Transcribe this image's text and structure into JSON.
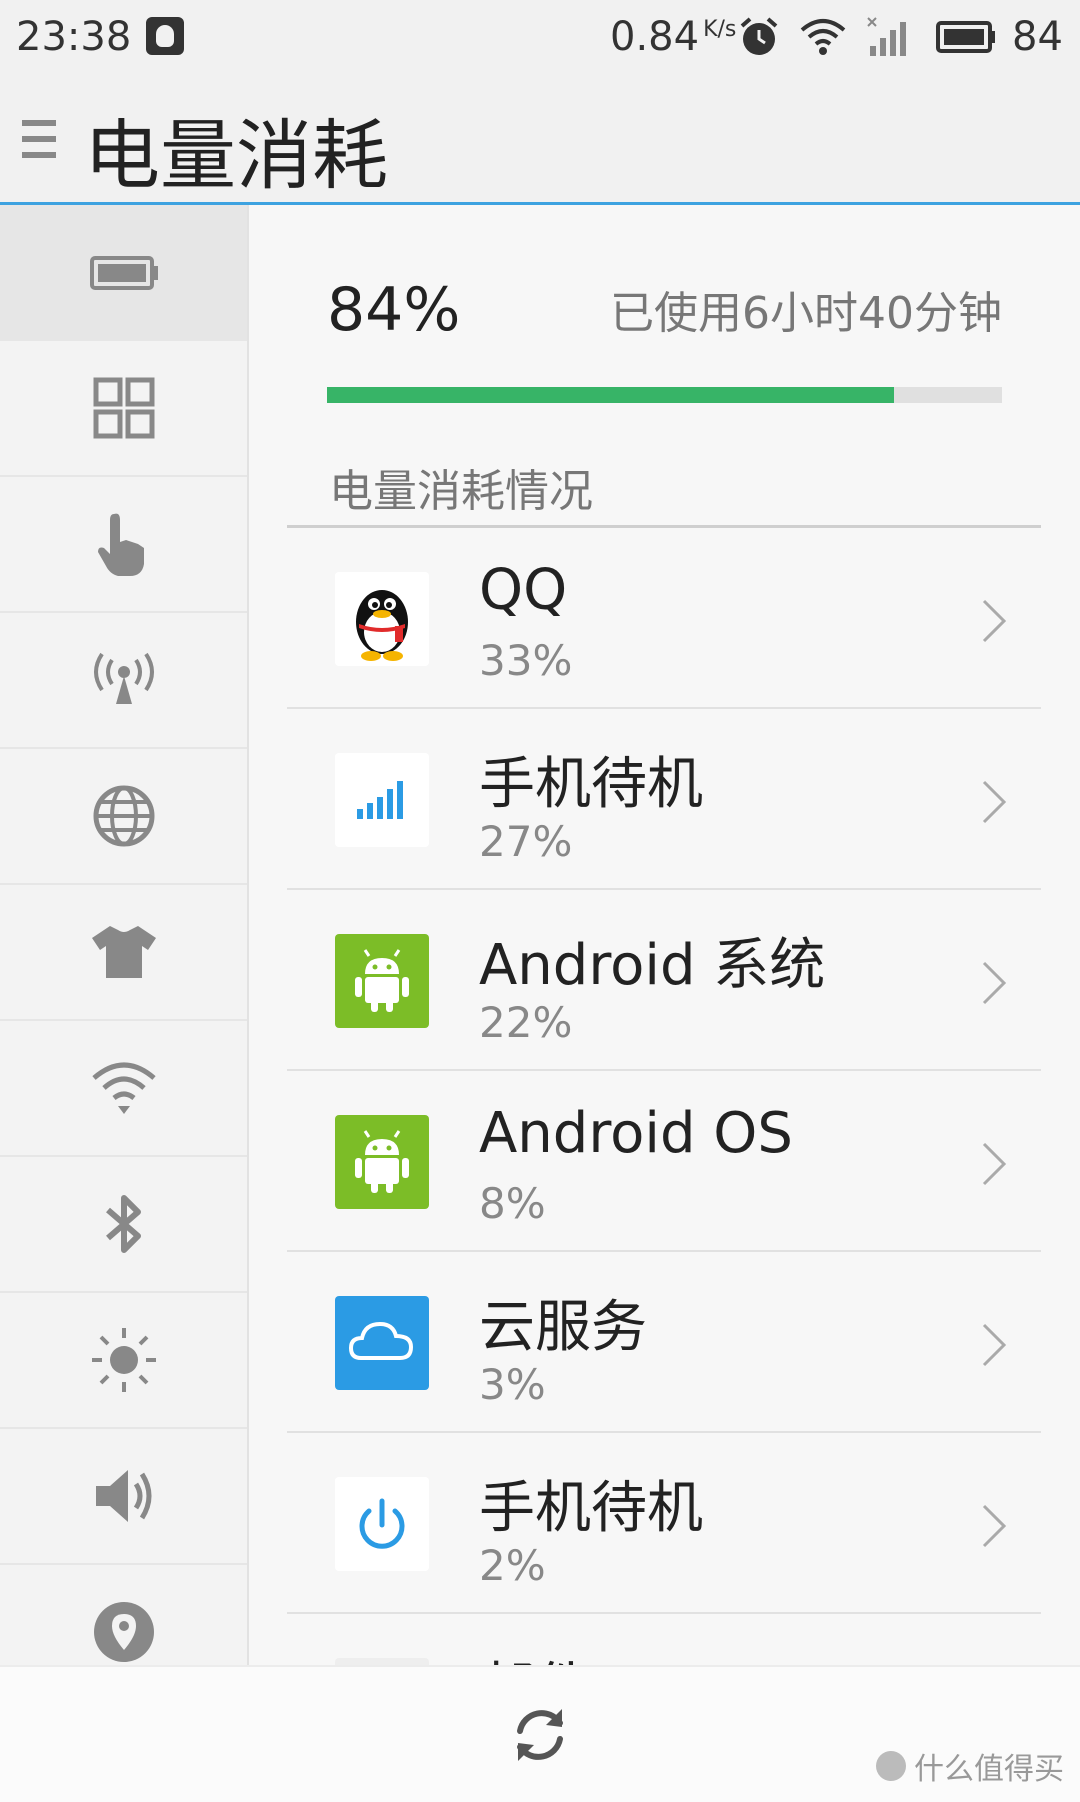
{
  "status_bar": {
    "time": "23:38",
    "speed_value": "0.84",
    "speed_unit": "K/s",
    "battery_level": "84"
  },
  "header": {
    "title": "电量消耗"
  },
  "sidebar": {
    "items": [
      {
        "icon": "battery-icon"
      },
      {
        "icon": "apps-grid-icon"
      },
      {
        "icon": "touch-hand-icon"
      },
      {
        "icon": "hotspot-icon"
      },
      {
        "icon": "globe-icon"
      },
      {
        "icon": "theme-shirt-icon"
      },
      {
        "icon": "wifi-icon"
      },
      {
        "icon": "bluetooth-icon"
      },
      {
        "icon": "brightness-icon"
      },
      {
        "icon": "volume-icon"
      },
      {
        "icon": "location-icon"
      }
    ],
    "active_index": 0
  },
  "battery": {
    "percent": "84%",
    "level": 0.84,
    "used_time": "已使用6小时40分钟"
  },
  "section": {
    "title": "电量消耗情况"
  },
  "apps": [
    {
      "name": "QQ",
      "percent": "33%",
      "icon": "qq-penguin-icon"
    },
    {
      "name": "手机待机",
      "percent": "27%",
      "icon": "signal-bars-icon"
    },
    {
      "name": "Android 系统",
      "percent": "22%",
      "icon": "android-icon"
    },
    {
      "name": "Android OS",
      "percent": "8%",
      "icon": "android-icon"
    },
    {
      "name": "云服务",
      "percent": "3%",
      "icon": "cloud-icon"
    },
    {
      "name": "手机待机",
      "percent": "2%",
      "icon": "power-icon"
    },
    {
      "name": "邮件",
      "percent": "",
      "icon": "mail-icon"
    }
  ],
  "colors": {
    "accent": "#3da2e0",
    "progress": "#37b467",
    "android_green": "#7cbd27",
    "cloud_blue": "#2b9be4"
  },
  "watermark": "什么值得买"
}
